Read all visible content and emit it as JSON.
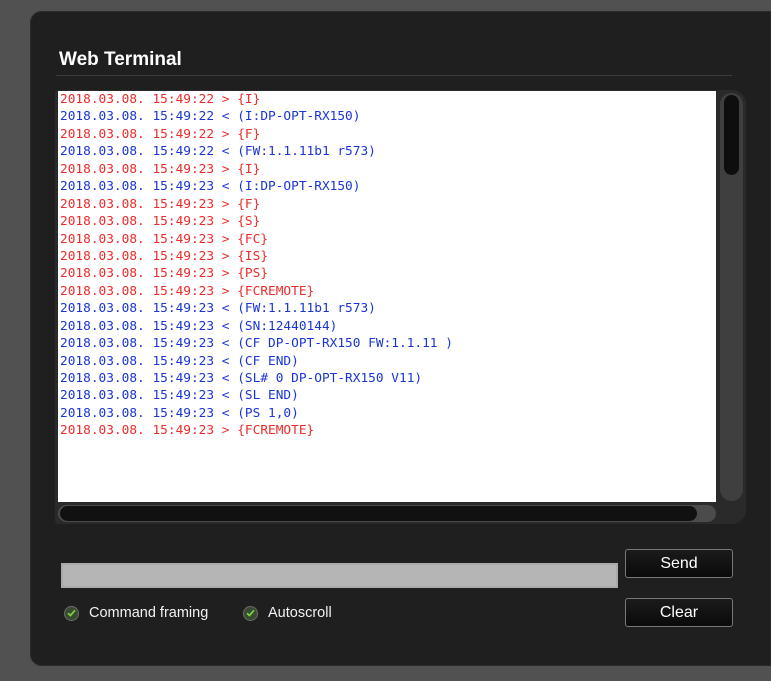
{
  "terminal": {
    "title": "Web Terminal",
    "lines": [
      {
        "text": "2018.03.08. 15:49:22 > {I}",
        "dir": "sent"
      },
      {
        "text": "2018.03.08. 15:49:22 < (I:DP-OPT-RX150)",
        "dir": "received"
      },
      {
        "text": "2018.03.08. 15:49:22 > {F}",
        "dir": "sent"
      },
      {
        "text": "2018.03.08. 15:49:22 < (FW:1.1.11b1 r573)",
        "dir": "received"
      },
      {
        "text": "2018.03.08. 15:49:23 > {I}",
        "dir": "sent"
      },
      {
        "text": "2018.03.08. 15:49:23 < (I:DP-OPT-RX150)",
        "dir": "received"
      },
      {
        "text": "2018.03.08. 15:49:23 > {F}",
        "dir": "sent"
      },
      {
        "text": "2018.03.08. 15:49:23 > {S}",
        "dir": "sent"
      },
      {
        "text": "2018.03.08. 15:49:23 > {FC}",
        "dir": "sent"
      },
      {
        "text": "2018.03.08. 15:49:23 > {IS}",
        "dir": "sent"
      },
      {
        "text": "2018.03.08. 15:49:23 > {PS}",
        "dir": "sent"
      },
      {
        "text": "2018.03.08. 15:49:23 > {FCREMOTE}",
        "dir": "sent"
      },
      {
        "text": "2018.03.08. 15:49:23 < (FW:1.1.11b1 r573)",
        "dir": "received"
      },
      {
        "text": "2018.03.08. 15:49:23 < (SN:12440144)",
        "dir": "received"
      },
      {
        "text": "2018.03.08. 15:49:23 < (CF DP-OPT-RX150 FW:1.1.11 )",
        "dir": "received"
      },
      {
        "text": "2018.03.08. 15:49:23 < (CF END)",
        "dir": "received"
      },
      {
        "text": "2018.03.08. 15:49:23 < (SL# 0 DP-OPT-RX150 V11)",
        "dir": "received"
      },
      {
        "text": "2018.03.08. 15:49:23 < (SL END)",
        "dir": "received"
      },
      {
        "text": "2018.03.08. 15:49:23 < (PS 1,0)",
        "dir": "received"
      },
      {
        "text": "2018.03.08. 15:49:23 > {FCREMOTE}",
        "dir": "sent"
      }
    ],
    "colors": {
      "sent": "#ef2a2a",
      "received": "#1a34d8"
    }
  },
  "command": {
    "value": "",
    "send_label": "Send",
    "clear_label": "Clear"
  },
  "options": {
    "command_framing": {
      "label": "Command framing",
      "checked": true,
      "icon": "check-icon"
    },
    "autoscroll": {
      "label": "Autoscroll",
      "checked": true,
      "icon": "check-icon"
    }
  }
}
